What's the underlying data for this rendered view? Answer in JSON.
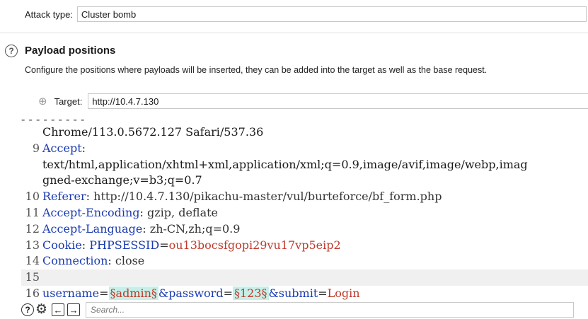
{
  "attack": {
    "label": "Attack type:",
    "value": "Cluster bomb"
  },
  "section": {
    "help_glyph": "?",
    "title": "Payload positions",
    "description": "Configure the positions where payloads will be inserted, they can be added into the target as well as the base request."
  },
  "target": {
    "label": "Target:",
    "value": "http://10.4.7.130"
  },
  "request": {
    "cut_line": "-  -     -                              -  - -        -     -    -",
    "lines": [
      {
        "num": "",
        "text": "Chrome/113.0.5672.127 Safari/537.36"
      },
      {
        "num": "9",
        "key": "Accept",
        "value": ":"
      },
      {
        "num": "",
        "text": "text/html,application/xhtml+xml,application/xml;q=0.9,image/avif,image/webp,imag"
      },
      {
        "num": "",
        "text": "gned-exchange;v=b3;q=0.7"
      },
      {
        "num": "10",
        "key": "Referer",
        "value": ": http://10.4.7.130/pikachu-master/vul/burteforce/bf_form.php"
      },
      {
        "num": "11",
        "key": "Accept-Encoding",
        "value": ": gzip, deflate"
      },
      {
        "num": "12",
        "key": "Accept-Language",
        "value": ": zh-CN,zh;q=0.9"
      },
      {
        "num": "13",
        "key": "Cookie",
        "sep": ": ",
        "ckey": "PHPSESSID",
        "ceq": "=",
        "cval": "ou13bocsfgopi29vu17vp5eip2"
      },
      {
        "num": "14",
        "key": "Connection",
        "value": ": close"
      },
      {
        "num": "15",
        "text": ""
      },
      {
        "num": "16",
        "p1": "username",
        "p2": "=",
        "m1": "§admin§",
        "p3": "&password",
        "p4": "=",
        "m2": "§123§",
        "p5": "&submit",
        "p6": "=",
        "p7": "Login"
      }
    ]
  },
  "toolbar": {
    "help_glyph": "?",
    "settings_glyph": "⚙",
    "back_glyph": "←",
    "forward_glyph": "→",
    "search_placeholder": "Search..."
  }
}
